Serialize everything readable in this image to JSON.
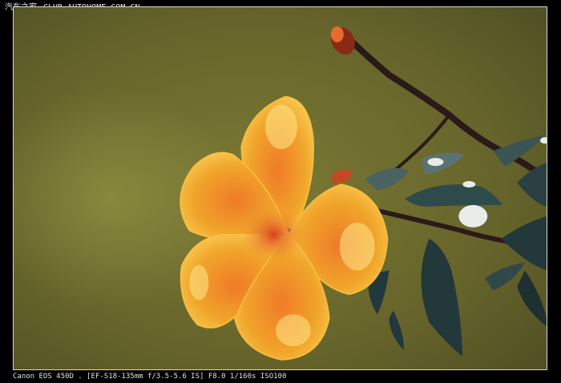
{
  "watermark": {
    "brand": "汽车之家",
    "site": "CLUB.AUTOHOME.COM.CN"
  },
  "caption": {
    "exif": "Canon EOS 450D . [EF-S18-135mm f/3.5-5.6 IS] F8.0 1/160s ISO100"
  },
  "photo": {
    "subject": "yellow-orange trumpet flower with dark green leaves on a blurred olive background",
    "colors": {
      "background": "#6a6a2c",
      "petal": "#f0a020",
      "petal_highlight": "#ffe07a",
      "center": "#e8502a",
      "leaf": "#22383a",
      "stem": "#2a1a18"
    }
  }
}
